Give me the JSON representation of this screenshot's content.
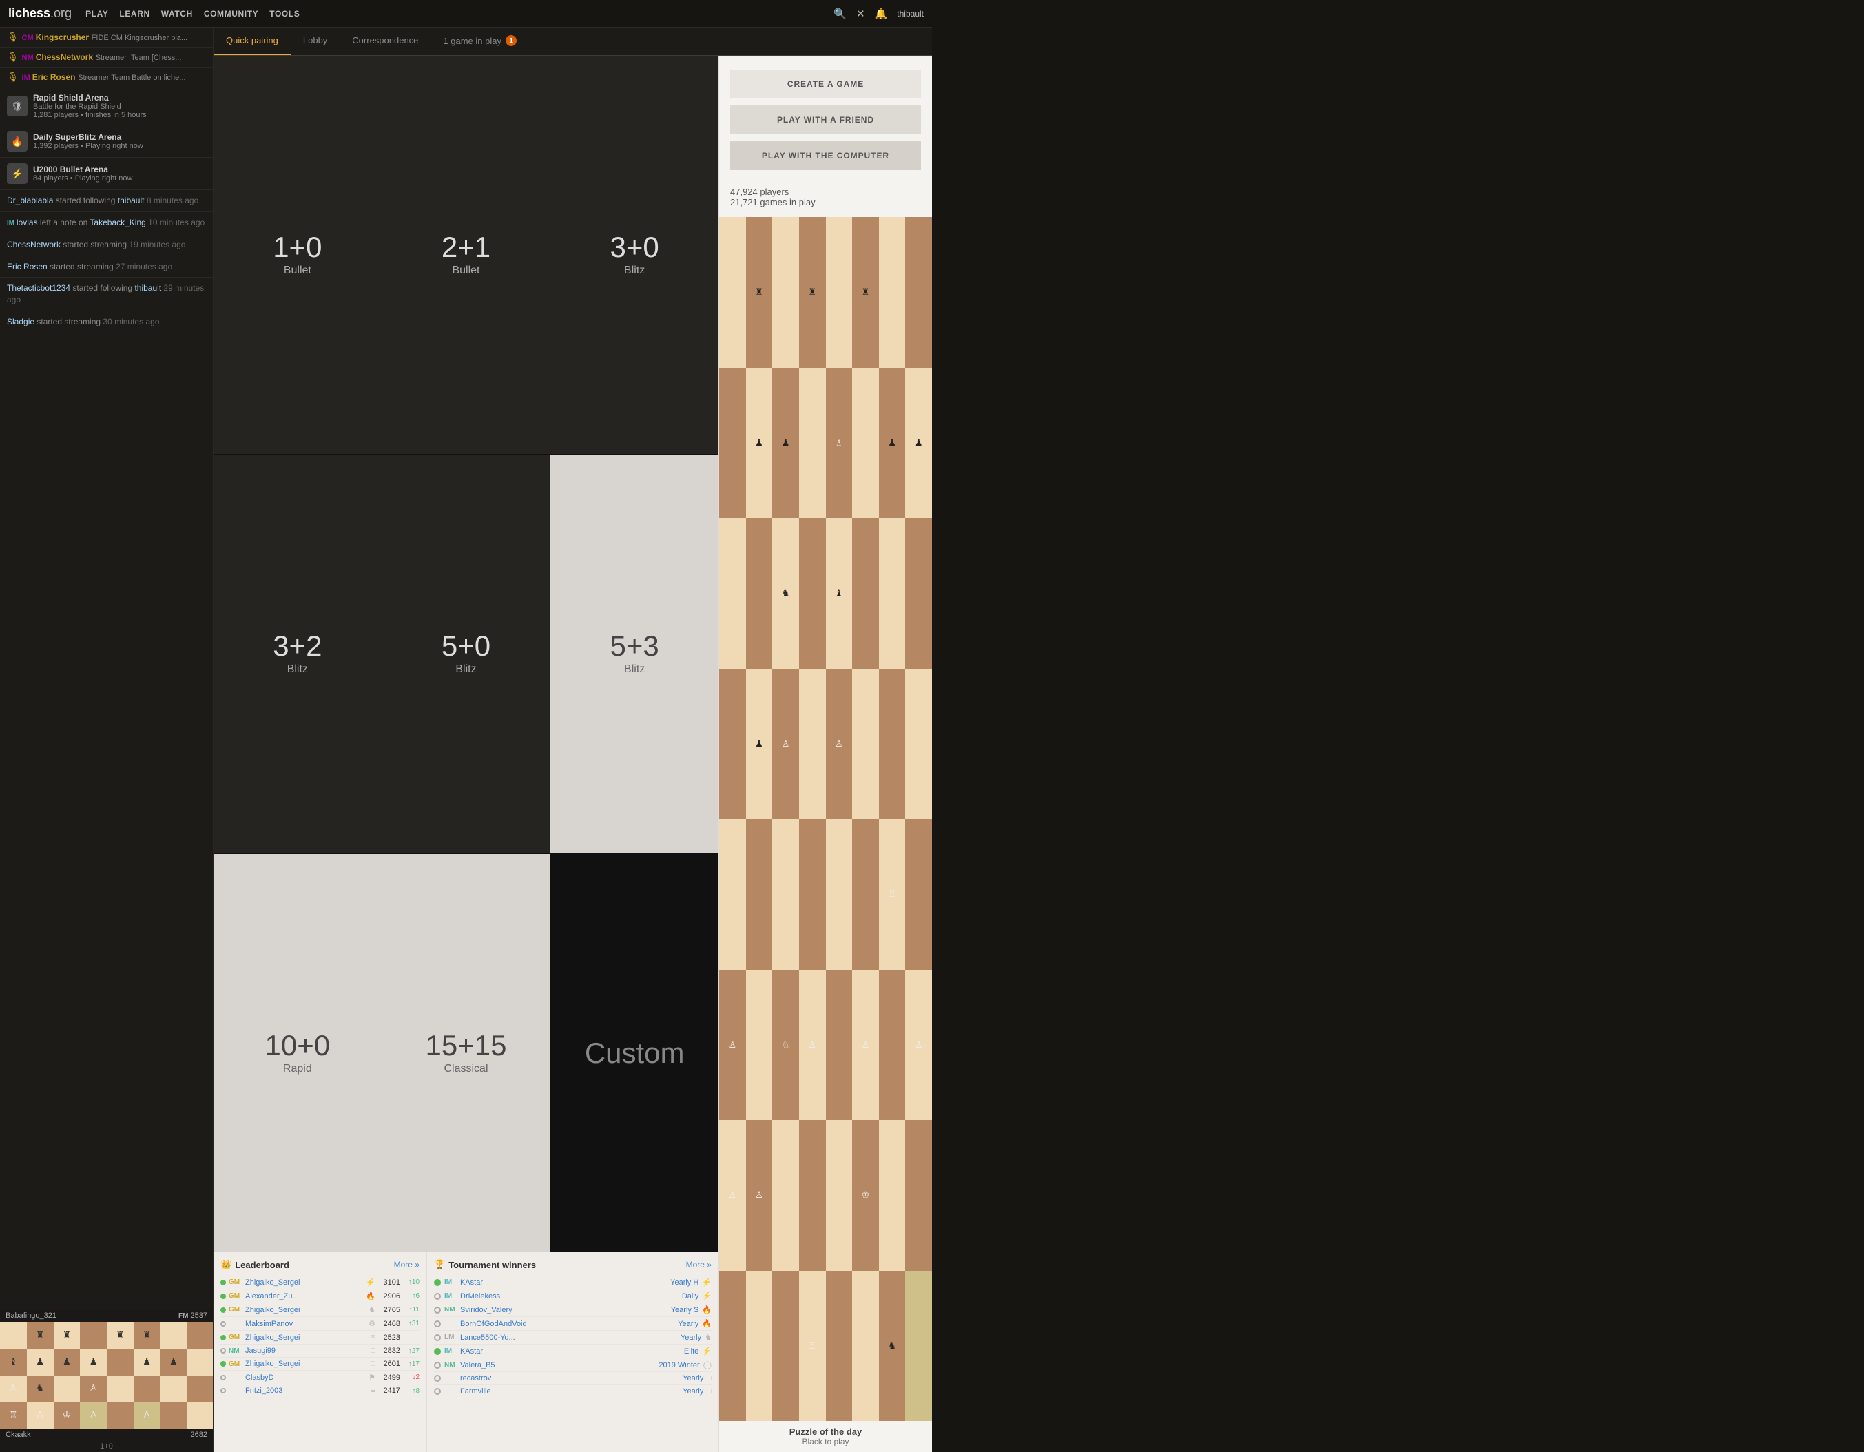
{
  "nav": {
    "logo": "lichess",
    "logo_ext": ".org",
    "links": [
      "PLAY",
      "LEARN",
      "WATCH",
      "COMMUNITY",
      "TOOLS"
    ],
    "user": "thibault"
  },
  "tabs": {
    "items": [
      {
        "label": "Quick pairing",
        "active": true
      },
      {
        "label": "Lobby",
        "active": false
      },
      {
        "label": "Correspondence",
        "active": false
      },
      {
        "label": "1 game in play",
        "active": false,
        "badge": "1"
      }
    ]
  },
  "quick_pairing": {
    "cells": [
      {
        "time": "1+0",
        "label": "Bullet",
        "theme": "dark"
      },
      {
        "time": "2+1",
        "label": "Bullet",
        "theme": "dark"
      },
      {
        "time": "3+0",
        "label": "Blitz",
        "theme": "dark"
      },
      {
        "time": "3+2",
        "label": "Blitz",
        "theme": "dark"
      },
      {
        "time": "5+0",
        "label": "Blitz",
        "theme": "dark"
      },
      {
        "time": "5+3",
        "label": "Blitz",
        "theme": "light"
      },
      {
        "time": "10+0",
        "label": "Rapid",
        "theme": "light"
      },
      {
        "time": "15+15",
        "label": "Classical",
        "theme": "light"
      },
      {
        "time": "Custom",
        "label": "",
        "theme": "custom"
      }
    ]
  },
  "actions": {
    "create": "CREATE A GAME",
    "friend": "PLAY WITH A FRIEND",
    "computer": "PLAY WITH THE COMPUTER"
  },
  "stats": {
    "players": "47,924 players",
    "games": "21,721 games in play"
  },
  "streamers": [
    {
      "title": "CM",
      "name": "Kingscrusher",
      "desc": "FIDE CM Kingscrusher pla..."
    },
    {
      "title": "NM",
      "name": "ChessNetwork",
      "desc": "Streamer !Team [Chess..."
    },
    {
      "title": "IM",
      "name": "Eric Rosen",
      "desc": "Streamer Team Battle on liche..."
    }
  ],
  "tournaments": [
    {
      "name": "Rapid Shield Arena",
      "sub": "Battle for the Rapid Shield",
      "detail": "1,281 players • finishes in 5 hours",
      "icon": "shield"
    },
    {
      "name": "Daily SuperBlitz Arena",
      "sub": "1,392 players • Playing right now",
      "icon": "fire"
    },
    {
      "name": "U2000 Bullet Arena",
      "sub": "84 players • Playing right now",
      "icon": "bolt"
    }
  ],
  "activity": [
    {
      "text": "Dr_blablabla started following thibault",
      "time": "8 minutes ago"
    },
    {
      "text": "IM lovlas left a note on Takeback_King",
      "time": "10 minutes ago"
    },
    {
      "text": "ChessNetwork started streaming",
      "time": "19 minutes ago"
    },
    {
      "text": "Eric Rosen started streaming",
      "time": "27 minutes ago"
    },
    {
      "text": "Thetacticbot1234 started following thibault",
      "time": "29 minutes ago"
    },
    {
      "text": "Sladgie started streaming",
      "time": "30 minutes ago"
    }
  ],
  "leaderboard": {
    "title": "Leaderboard",
    "more": "More »",
    "rows": [
      {
        "title": "GM",
        "name": "Zhigalko_Sergei",
        "icon": "⚡",
        "rating": "3101",
        "progress": "↑10",
        "up": true
      },
      {
        "title": "GM",
        "name": "Alexander_Zu...",
        "icon": "🔥",
        "rating": "2906",
        "progress": "↑6",
        "up": true
      },
      {
        "title": "GM",
        "name": "Zhigalko_Sergei",
        "icon": "♞",
        "rating": "2765",
        "progress": "↑11",
        "up": true
      },
      {
        "title": "",
        "name": "MaksimPanov",
        "icon": "⚙",
        "rating": "2468",
        "progress": "↑31",
        "up": true
      },
      {
        "title": "GM",
        "name": "Zhigalko_Sergei",
        "icon": "🖱",
        "rating": "2523",
        "progress": "",
        "up": true
      },
      {
        "title": "NM",
        "name": "Jasugi99",
        "icon": "□",
        "rating": "2832",
        "progress": "↑27",
        "up": true
      },
      {
        "title": "GM",
        "name": "Zhigalko_Sergei",
        "icon": "□",
        "rating": "2601",
        "progress": "↑17",
        "up": true
      },
      {
        "title": "",
        "name": "ClasbyD",
        "icon": "⚑",
        "rating": "2499",
        "progress": "↓2",
        "up": false
      },
      {
        "title": "",
        "name": "Fritzi_2003",
        "icon": "≡",
        "rating": "2417",
        "progress": "↑8",
        "up": true
      }
    ]
  },
  "tournament_winners": {
    "title": "Tournament winners",
    "more": "More »",
    "rows": [
      {
        "dot": true,
        "title": "IM",
        "name": "KAstar",
        "tournament": "Yearly H",
        "icon": "⚡"
      },
      {
        "dot": false,
        "title": "IM",
        "name": "DrMelekess",
        "tournament": "Daily",
        "icon": "⚡"
      },
      {
        "dot": false,
        "title": "NM",
        "name": "Sviridov_Valery",
        "tournament": "Yearly S",
        "icon": "🔥"
      },
      {
        "dot": false,
        "title": "",
        "name": "BornOfGodAndVoid",
        "tournament": "Yearly",
        "icon": "🔥"
      },
      {
        "dot": false,
        "title": "LM",
        "name": "Lance5500-Yo...",
        "tournament": "Yearly",
        "icon": "♞"
      },
      {
        "dot": true,
        "title": "IM",
        "name": "KAstar",
        "tournament": "Elite",
        "icon": "⚡"
      },
      {
        "dot": false,
        "title": "NM",
        "name": "Valera_B5",
        "tournament": "2019 Winter",
        "icon": "◯"
      },
      {
        "dot": false,
        "title": "",
        "name": "recastrov",
        "tournament": "Yearly",
        "icon": "□"
      },
      {
        "dot": false,
        "title": "",
        "name": "Farmville",
        "tournament": "Yearly",
        "icon": "□"
      }
    ]
  },
  "mini_game": {
    "white_player": "Ckaakk",
    "white_rating": "2682",
    "black_player": "Babafingo_321",
    "black_rating": "2537",
    "time": "1+0",
    "black_title": "FM"
  },
  "puzzle": {
    "title": "Puzzle of the day",
    "sub": "Black to play"
  }
}
